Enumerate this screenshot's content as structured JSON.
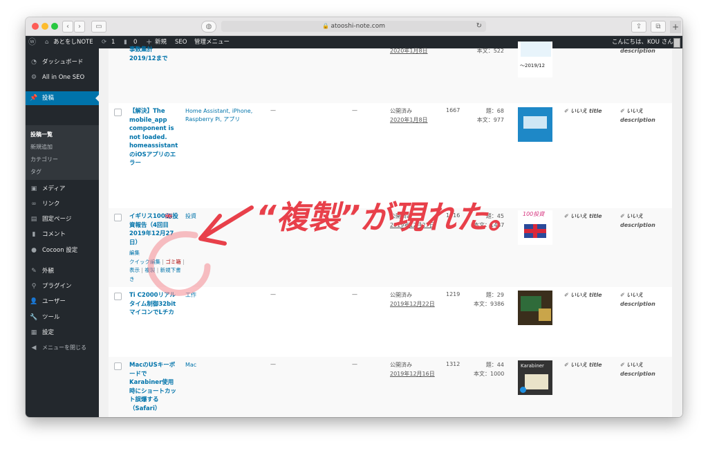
{
  "browser": {
    "url": "atooshi-note.com",
    "privacy_icon": "shield-icon"
  },
  "adminbar": {
    "site_name": "あとをしNOTE",
    "updates_count": "1",
    "comments_count": "0",
    "new_label": "新規",
    "seo_label": "SEO",
    "admin_menu_label": "管理メニュー",
    "greeting": "こんにちは、KOU さん"
  },
  "sidebar": {
    "items": [
      {
        "icon": "dashboard-icon",
        "label": "ダッシュボード"
      },
      {
        "icon": "gear-icon",
        "label": "All in One SEO"
      },
      {
        "icon": "pin-icon",
        "label": "投稿"
      },
      {
        "icon": "media-icon",
        "label": "メディア"
      },
      {
        "icon": "link-icon",
        "label": "リンク"
      },
      {
        "icon": "page-icon",
        "label": "固定ページ"
      },
      {
        "icon": "comment-icon",
        "label": "コメント"
      },
      {
        "icon": "cocoon-icon",
        "label": "Cocoon 設定"
      },
      {
        "icon": "appearance-icon",
        "label": "外観"
      },
      {
        "icon": "plugin-icon",
        "label": "プラグイン"
      },
      {
        "icon": "user-icon",
        "label": "ユーザー"
      },
      {
        "icon": "tool-icon",
        "label": "ツール"
      },
      {
        "icon": "settings-icon",
        "label": "設定"
      },
      {
        "icon": "collapse-icon",
        "label": "メニューを閉じる"
      }
    ],
    "submenu": [
      "投稿一覧",
      "新規追加",
      "カテゴリー",
      "タグ"
    ]
  },
  "rows": [
    {
      "title": "事数集計 2019/12まで",
      "categories": "",
      "status": "",
      "date": "2020年1月8日",
      "views": "",
      "title_count": "",
      "body_count": "本文：522",
      "seo_title_label": "",
      "seo_desc_label": "description"
    },
    {
      "title": "【解決】The mobile_app component is not loaded. homeassistantのiOSアプリのエラー",
      "categories": "Home Assistant, iPhone, Raspberry Pi, アプリ",
      "tags": "—",
      "comments": "—",
      "status": "公開済み",
      "date": "2020年1月8日",
      "views": "1667",
      "title_count": "題：68",
      "body_count": "本文：977",
      "seo_title_label": "いいえ title",
      "seo_desc_label_1": "いいえ",
      "seo_desc_label_2": "description"
    },
    {
      "title": "イギリス100🇬🇧投資報告（4回目2019年12月27日）",
      "categories": "投資",
      "status": "公開済み",
      "date": "2019年12月27日",
      "views": "1516",
      "title_count": "題：45",
      "body_count": "本文：1487",
      "seo_title_label": "いいえ title",
      "seo_desc_label_1": "いいえ",
      "seo_desc_label_2": "description",
      "actions": {
        "edit": "編集",
        "quick_edit": "クイック編集",
        "trash": "ゴミ箱",
        "view": "表示",
        "duplicate": "複製",
        "new_draft": "新規下書き"
      }
    },
    {
      "title": "Ti C2000リアルタイム制御32bitマイコンでLチカ",
      "categories": "工作",
      "tags": "—",
      "comments": "—",
      "status": "公開済み",
      "date": "2019年12月22日",
      "views": "1219",
      "title_count": "題：29",
      "body_count": "本文：9386",
      "seo_title_label": "いいえ title",
      "seo_desc_label_1": "いいえ",
      "seo_desc_label_2": "description"
    },
    {
      "title": "MacのUSキーボードでKarabiner使用時にショートカット誤爆する（Safari）",
      "categories": "Mac",
      "tags": "—",
      "comments": "—",
      "status": "公開済み",
      "date": "2019年12月16日",
      "views": "1312",
      "title_count": "題：44",
      "body_count": "本文：1000",
      "seo_title_label": "いいえ title",
      "seo_desc_label_1": "いいえ",
      "seo_desc_label_2": "description"
    }
  ],
  "annotation": {
    "text": "“複製”が現れた。",
    "color": "#e8404a"
  },
  "thumbnails": {
    "t1_handwritten": "～2019/12",
    "t3_label": "100投資",
    "t5_label": "Karabiner"
  }
}
